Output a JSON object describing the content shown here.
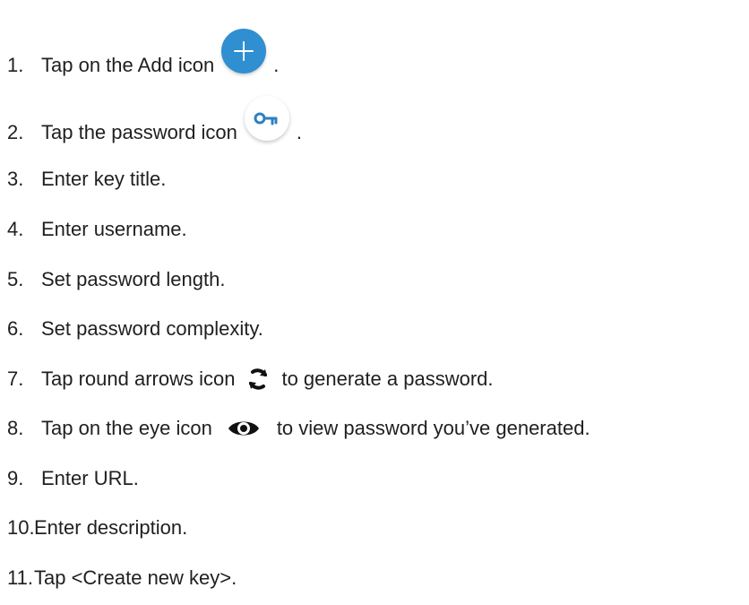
{
  "steps": [
    {
      "number": "1.",
      "text_before": "Tap on the Add icon",
      "text_after": ".",
      "icon": "plus-icon"
    },
    {
      "number": "2.",
      "text_before": "Tap the password icon",
      "text_after": ".",
      "icon": "key-icon"
    },
    {
      "number": "3.",
      "text": "Enter key title."
    },
    {
      "number": "4.",
      "text": "Enter username."
    },
    {
      "number": "5.",
      "text": "Set password length."
    },
    {
      "number": "6.",
      "text": "Set password complexity."
    },
    {
      "number": "7.",
      "text_before": "Tap round arrows icon",
      "text_after": "to generate a password.",
      "icon": "refresh-icon"
    },
    {
      "number": "8.",
      "text_before": "Tap on the eye icon",
      "text_after": "to view password you’ve generated.",
      "icon": "eye-icon"
    },
    {
      "number": "9.",
      "text": "Enter URL."
    },
    {
      "number": "10.",
      "text": "Enter description."
    },
    {
      "number": "11.",
      "text": "Tap <Create new key>."
    }
  ],
  "colors": {
    "accent": "#2f8fd1",
    "text": "#1f1f1f"
  }
}
